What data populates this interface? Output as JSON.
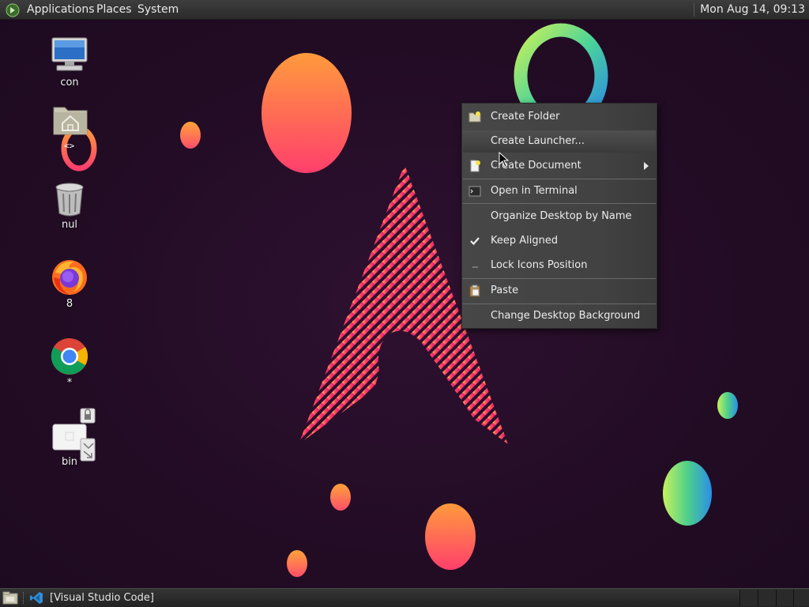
{
  "top_panel": {
    "menus": [
      "Applications",
      "Places",
      "System"
    ],
    "clock": "Mon Aug 14, 09:13"
  },
  "desktop": {
    "icons": [
      {
        "label": "con",
        "icon": "computer-icon"
      },
      {
        "label": "",
        "icon": "home-folder-icon"
      },
      {
        "label": "nul",
        "icon": "trash-icon"
      },
      {
        "label": "8",
        "icon": "firefox-icon"
      },
      {
        "label": "*",
        "icon": "chrome-icon"
      },
      {
        "label": "bin",
        "icon": "document-icon"
      }
    ],
    "home_overlay_glyph": "<>"
  },
  "context_menu": {
    "items": [
      {
        "label": "Create Folder",
        "icon": "folder-new-icon"
      },
      {
        "label": "Create Launcher...",
        "icon": ""
      },
      {
        "label": "Create Document",
        "icon": "document-new-icon",
        "submenu": true
      },
      {
        "label": "Open in Terminal",
        "icon": "terminal-icon"
      },
      {
        "label": "Organize Desktop by Name",
        "icon": ""
      },
      {
        "label": "Keep Aligned",
        "icon": "check-icon",
        "checked": true
      },
      {
        "label": "Lock Icons Position",
        "icon": "dash-icon"
      },
      {
        "label": "Paste",
        "icon": "paste-icon"
      },
      {
        "label": "Change Desktop Background",
        "icon": ""
      }
    ],
    "hovered_index": 1
  },
  "bottom_panel": {
    "task_label": "[Visual Studio Code]"
  },
  "colors": {
    "background": "#230c25",
    "accent_pink": "#e8206a",
    "accent_orange": "#ff9540",
    "panel": "#2f2f2f"
  }
}
